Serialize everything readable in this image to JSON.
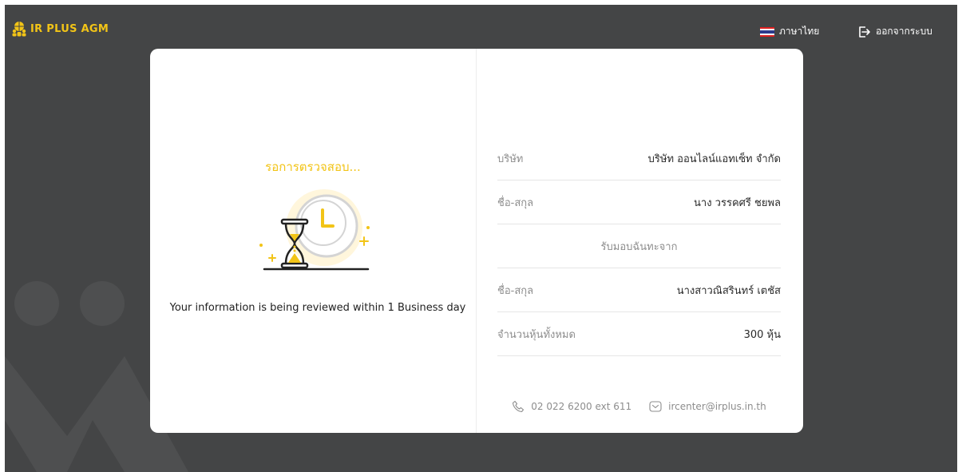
{
  "header": {
    "brand": "IR PLUS AGM",
    "language_label": "ภาษาไทย",
    "logout_label": "ออกจากระบบ"
  },
  "status": {
    "title": "รอการตรวจสอบ...",
    "message": "Your information is being reviewed within 1 Business day"
  },
  "details": {
    "company_label": "บริษัท",
    "company_value": "บริษัท ออนไลน์แอทเซ็ท จำกัด",
    "name_label": "ชื่อ-สกุล",
    "name_value": "นาง วรรคศรี ชยพล",
    "proxy_heading": "รับมอบฉันทะจาก",
    "proxy_name_label": "ชื่อ-สกุล",
    "proxy_name_value": "นางสาวณิสรินทร์ เตชัส",
    "shares_label": "จำนวนหุ้นทั้งหมด",
    "shares_value": "300 หุ้น"
  },
  "contact": {
    "phone": "02 022 6200 ext 611",
    "email": "ircenter@irplus.in.th"
  },
  "colors": {
    "accent": "#f2c417",
    "background": "#444546",
    "card": "#ffffff"
  },
  "icons": [
    "globe-people-icon",
    "thai-flag-icon",
    "logout-icon",
    "hourglass-icon",
    "clock-icon",
    "phone-icon",
    "mail-icon"
  ]
}
